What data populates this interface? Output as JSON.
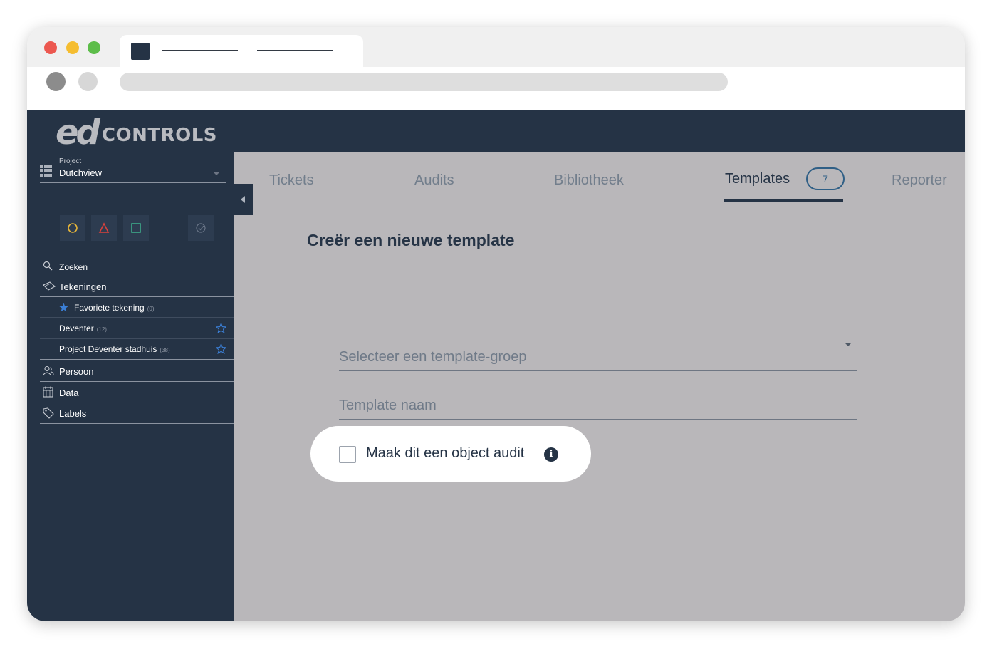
{
  "app": {
    "logo_mark": "ed",
    "logo_text": "CONTROLS"
  },
  "sidebar": {
    "project_label": "Project",
    "project_name": "Dutchview",
    "search": "Zoeken",
    "drawings": "Tekeningen",
    "sub_items": [
      {
        "label": "Favoriete tekening",
        "count": "(0)"
      },
      {
        "label": "Deventer",
        "count": "(12)"
      },
      {
        "label": "Project Deventer stadhuis",
        "count": "(38)"
      }
    ],
    "person": "Persoon",
    "data": "Data",
    "labels": "Labels"
  },
  "tabs": {
    "tickets": "Tickets",
    "audits": "Audits",
    "library": "Bibliotheek",
    "templates": "Templates",
    "templates_count": "7",
    "reporter": "Reporter"
  },
  "form": {
    "heading": "Creër een nieuwe template",
    "group_placeholder": "Selecteer een template-groep",
    "name_placeholder": "Template naam",
    "object_audit_label": "Maak dit een object audit",
    "info_glyph": "i"
  },
  "colors": {
    "navy": "#253345",
    "overlay_gray": "#b9b7ba",
    "accent_blue": "#2f5f86",
    "circle_yellow": "#e5b53a",
    "triangle_red": "#d9413c",
    "square_green": "#3daa8a"
  }
}
